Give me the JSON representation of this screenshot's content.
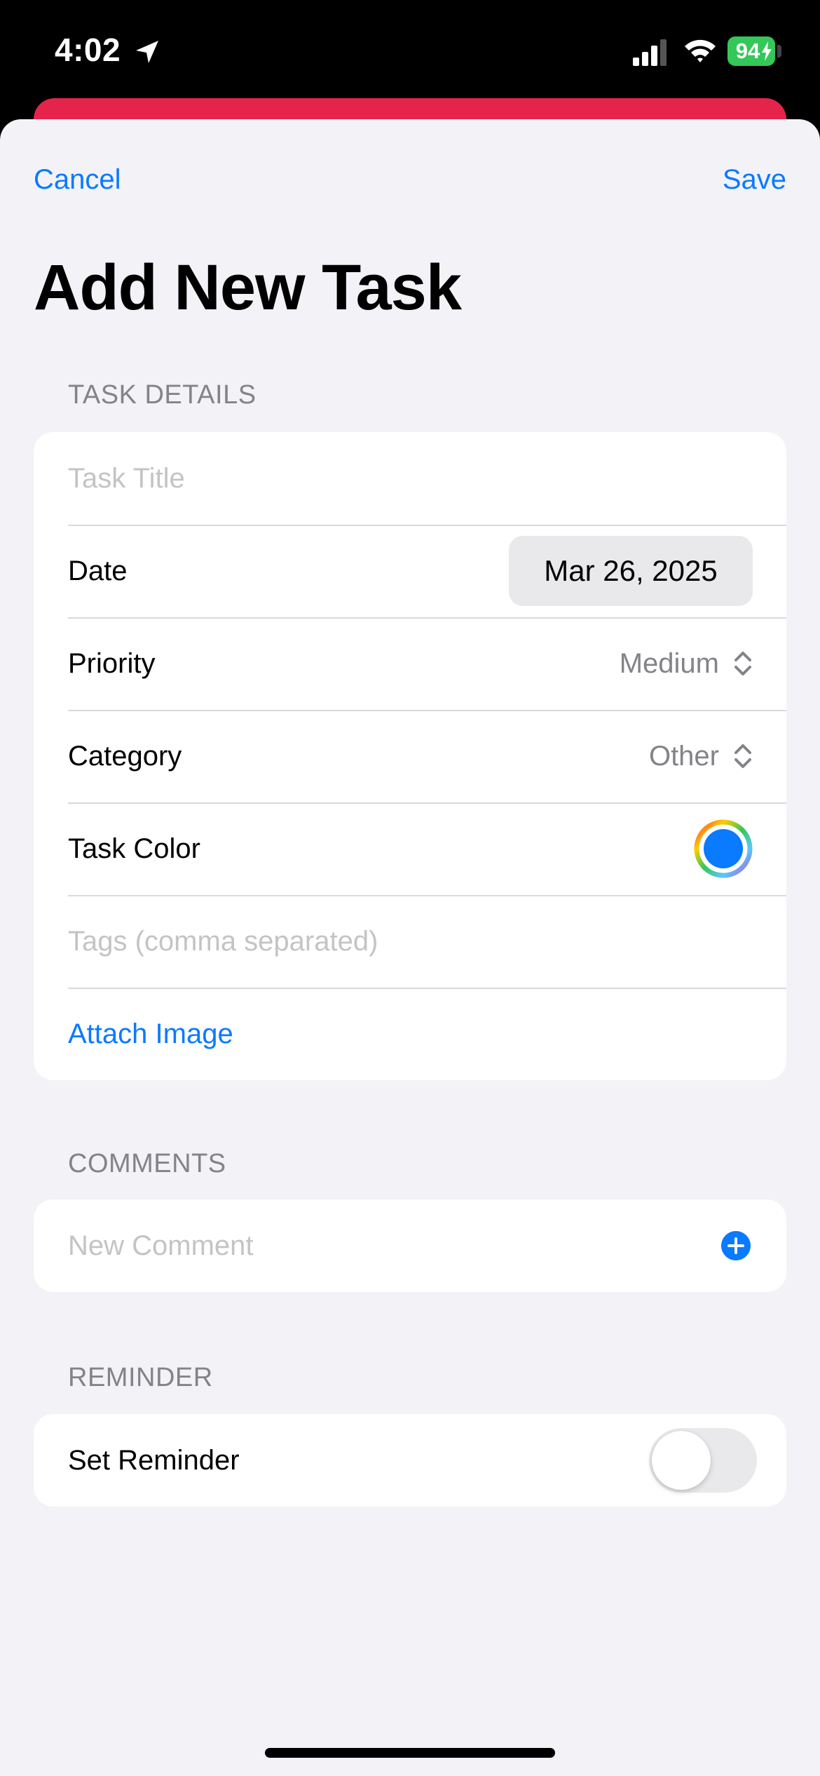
{
  "status_bar": {
    "time": "4:02",
    "battery": "94"
  },
  "nav": {
    "cancel_label": "Cancel",
    "save_label": "Save"
  },
  "title": "Add New Task",
  "task_details": {
    "header": "TASK DETAILS",
    "title_placeholder": "Task Title",
    "date_label": "Date",
    "date_value": "Mar 26, 2025",
    "priority_label": "Priority",
    "priority_value": "Medium",
    "category_label": "Category",
    "category_value": "Other",
    "color_label": "Task Color",
    "color_value": "#0a7aff",
    "tags_placeholder": "Tags (comma separated)",
    "attach_label": "Attach Image"
  },
  "comments": {
    "header": "COMMENTS",
    "placeholder": "New Comment"
  },
  "reminder": {
    "header": "REMINDER",
    "label": "Set Reminder",
    "enabled": false
  },
  "colors": {
    "accent": "#0a7aff",
    "card_red": "#e5234b",
    "battery_green": "#34c759"
  },
  "icons": [
    "location-arrow-icon",
    "cellular-signal-icon",
    "wifi-icon",
    "battery-bolt-icon",
    "chevron-updown-icon",
    "color-wheel-icon",
    "plus-circle-icon"
  ]
}
